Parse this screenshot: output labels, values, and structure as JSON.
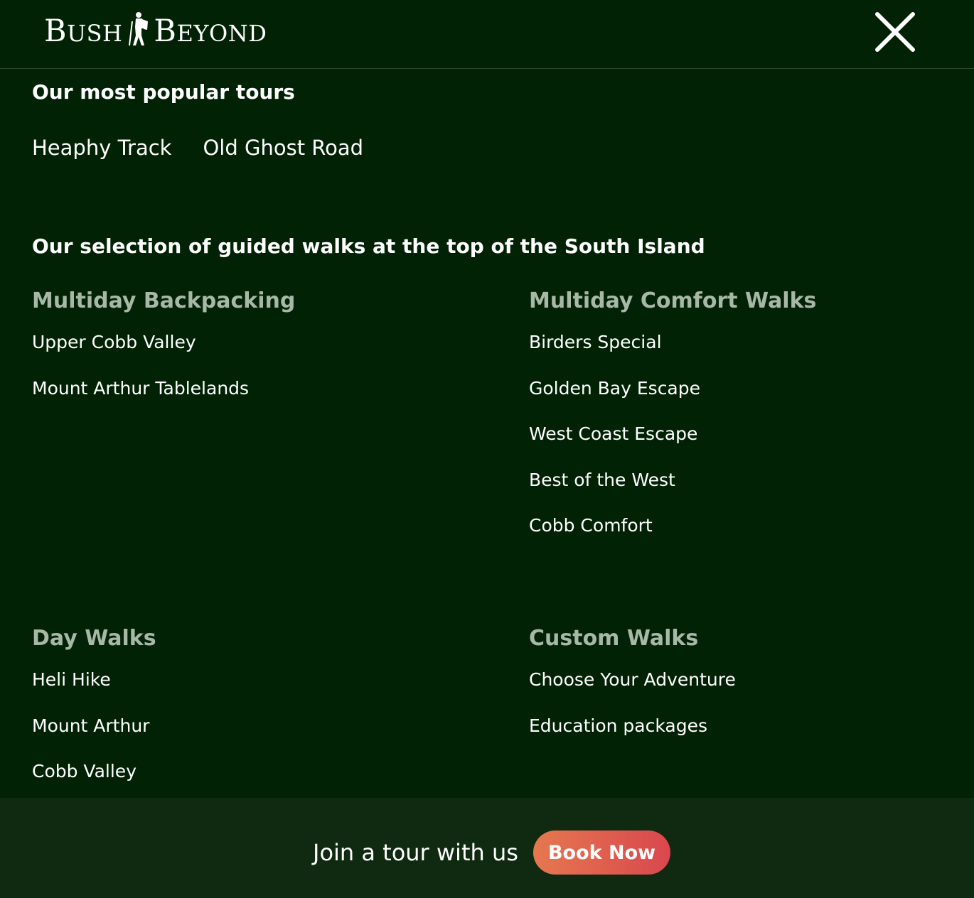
{
  "brand": {
    "logo_left": "BUSH",
    "logo_right": "BEYOND"
  },
  "popular": {
    "heading": "Our most popular tours",
    "links": [
      "Heaphy Track",
      "Old Ghost Road"
    ]
  },
  "selection_heading": "Our selection of guided walks at the top of the South Island",
  "groups": [
    {
      "title": "Multiday Backpacking",
      "items": [
        "Upper Cobb Valley",
        "Mount Arthur Tablelands"
      ]
    },
    {
      "title": "Multiday Comfort Walks",
      "items": [
        "Birders Special",
        "Golden Bay Escape",
        "West Coast Escape",
        "Best of the West",
        "Cobb Comfort"
      ]
    },
    {
      "title": "Day Walks",
      "items": [
        "Heli Hike",
        "Mount Arthur",
        "Cobb Valley"
      ]
    },
    {
      "title": "Custom Walks",
      "items": [
        "Choose Your Adventure",
        "Education packages"
      ]
    }
  ],
  "footer": {
    "tagline": "Join a tour with us",
    "cta_label": "Book Now"
  },
  "icons": {
    "close": "close-icon",
    "logo_figure": "hiker-icon"
  },
  "colors": {
    "background": "#022205",
    "footer_bg": "#0f2a11",
    "group_title": "#a7b8a6",
    "cta_start": "#e5784f",
    "cta_end": "#d9474e"
  }
}
